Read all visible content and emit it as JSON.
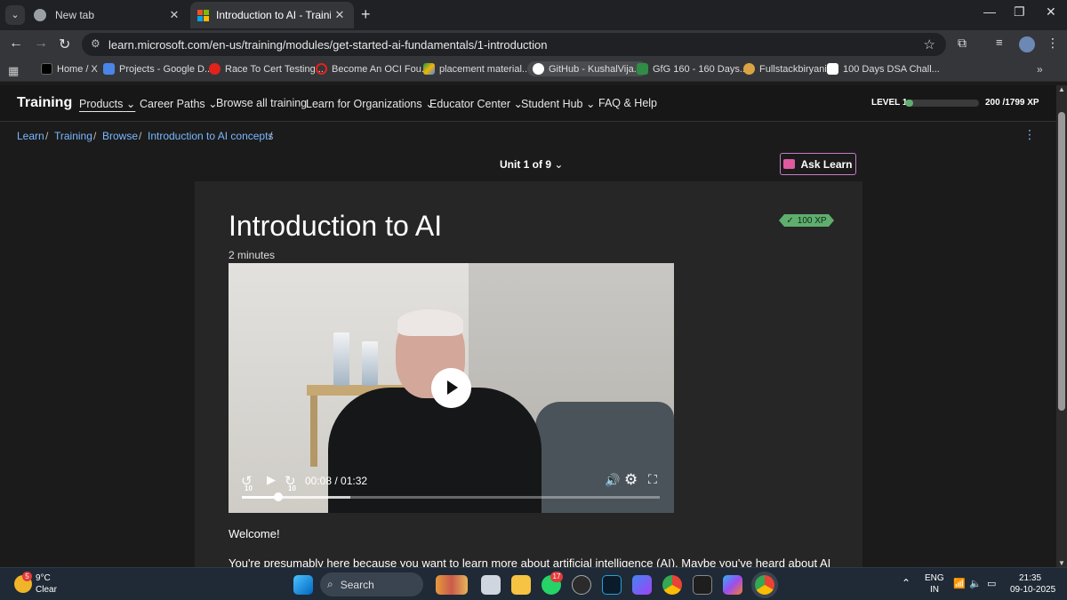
{
  "browser": {
    "tabs": [
      {
        "title": "New tab",
        "active": false
      },
      {
        "title": "Introduction to AI - Training | M",
        "active": true
      }
    ],
    "url": "learn.microsoft.com/en-us/training/modules/get-started-ai-fundamentals/1-introduction",
    "bookmarks": [
      "Home / X",
      "Projects - Google D...",
      "Race To Cert Testing...",
      "Become An OCI Fou...",
      "placement material...",
      "GitHub - KushalVija...",
      "GfG 160 - 160 Days...",
      "Fullstackbiryani",
      "100 Days DSA Chall..."
    ]
  },
  "site": {
    "brand": "Training",
    "nav": [
      "Products",
      "Career Paths",
      "Browse all training",
      "Learn for Organizations",
      "Educator Center",
      "Student Hub",
      "FAQ & Help"
    ],
    "level_label": "LEVEL 1",
    "xp_text": "200 /1799 XP",
    "xp_fraction": 0.111
  },
  "breadcrumb": [
    "Learn",
    "Training",
    "Browse",
    "Introduction to AI concepts"
  ],
  "unit_selector": "Unit 1 of 9",
  "ask_learn": "Ask Learn",
  "lesson": {
    "title": "Introduction to AI",
    "duration": "2 minutes",
    "xp_badge": "100 XP",
    "welcome": "Welcome!",
    "intro_line": "You're presumably here because you want to learn more about artificial intelligence (AI). Maybe you've heard about AI in"
  },
  "video": {
    "time": "00:08 / 01:32",
    "rewind_label": "10",
    "forward_label": "10",
    "progress_fraction": 0.087,
    "buffer_fraction": 0.26
  },
  "taskbar": {
    "weather_temp": "9°C",
    "weather_desc": "Clear",
    "weather_badge": "5",
    "search_label": "Search",
    "whatsapp_badge": "17",
    "lang_top": "ENG",
    "lang_bottom": "IN",
    "clock_time": "21:35",
    "clock_date": "09-10-2025"
  }
}
